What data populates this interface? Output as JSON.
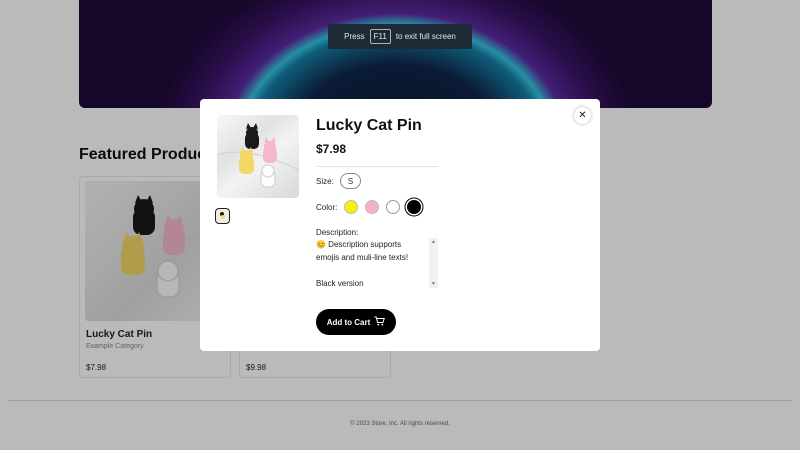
{
  "fullscreen_notice": {
    "prefix": "Press",
    "key": "F11",
    "suffix": "to exit full screen"
  },
  "section": {
    "title": "Featured Products"
  },
  "cards": [
    {
      "name": "Lucky Cat Pin",
      "category": "Example Category",
      "price": "$7.98"
    },
    {
      "name": "",
      "category": "",
      "price": "$9.98"
    }
  ],
  "footer": {
    "text": "© 2023 Store, Inc. All rights reserved."
  },
  "modal": {
    "title": "Lucky Cat Pin",
    "price": "$7.98",
    "size_label": "Size:",
    "sizes": [
      "S"
    ],
    "color_label": "Color:",
    "colors": [
      "#f7f200",
      "#f6b2c4",
      "#ffffff",
      "#000000"
    ],
    "selected_color": "#000000",
    "description_label": "Description:",
    "description": "😊 Description supports emojis and muli-line texts!\n\nBlack version",
    "add_to_cart": "Add to Cart",
    "close_icon": "close-icon",
    "cart_icon": "cart-icon"
  }
}
